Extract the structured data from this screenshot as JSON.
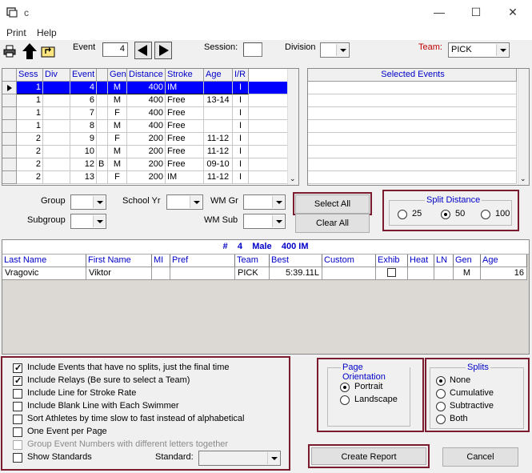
{
  "window": {
    "title": "c",
    "minimize": "—",
    "maximize": "☐",
    "close": "✕"
  },
  "menu": [
    "Print",
    "Help"
  ],
  "toolbar": {
    "event_label": "Event",
    "event_value": "4",
    "session_label": "Session:",
    "session_value": "",
    "division_label": "Division",
    "division_value": "",
    "team_label": "Team:",
    "team_value": "PICK",
    "team_color": "#c00000"
  },
  "events_grid": {
    "headers": [
      "Sess",
      "Div",
      "Event",
      "",
      "Gen",
      "Distance",
      "Stroke",
      "Age",
      "I/R"
    ],
    "rows": [
      [
        "1",
        "",
        "4",
        "",
        "M",
        "400",
        "IM",
        "",
        "I"
      ],
      [
        "1",
        "",
        "6",
        "",
        "M",
        "400",
        "Free",
        "13-14",
        "I"
      ],
      [
        "1",
        "",
        "7",
        "",
        "F",
        "400",
        "Free",
        "",
        "I"
      ],
      [
        "1",
        "",
        "8",
        "",
        "M",
        "400",
        "Free",
        "",
        "I"
      ],
      [
        "2",
        "",
        "9",
        "",
        "F",
        "200",
        "Free",
        "11-12",
        "I"
      ],
      [
        "2",
        "",
        "10",
        "",
        "M",
        "200",
        "Free",
        "11-12",
        "I"
      ],
      [
        "2",
        "",
        "12",
        "B",
        "M",
        "200",
        "Free",
        "09-10",
        "I"
      ],
      [
        "2",
        "",
        "13",
        "",
        "F",
        "200",
        "IM",
        "11-12",
        "I"
      ]
    ],
    "selected_row": 0
  },
  "selected_events": {
    "header": "Selected Events"
  },
  "filters": {
    "group_label": "Group",
    "subgroup_label": "Subgroup",
    "school_yr_label": "School Yr",
    "wm_gr_label": "WM Gr",
    "wm_sub_label": "WM Sub"
  },
  "buttons": {
    "select_all": "Select All",
    "clear_all": "Clear All",
    "create_report": "Create Report",
    "cancel": "Cancel"
  },
  "split_distance": {
    "title": "Split Distance",
    "options": [
      "25",
      "50",
      "100"
    ],
    "selected": 1
  },
  "swimmers": {
    "title_parts": [
      "#",
      "4",
      "Male",
      "400 IM"
    ],
    "headers": [
      "Last Name",
      "First Name",
      "MI",
      "Pref",
      "Team",
      "Best",
      "Custom",
      "Exhib",
      "Heat",
      "LN",
      "Gen",
      "Age"
    ],
    "rows": [
      [
        "Vragovic",
        "Viktor",
        "",
        "",
        "PICK",
        "5:39.11L",
        "",
        "",
        "",
        "",
        "M",
        "16"
      ]
    ]
  },
  "options": [
    {
      "label": "Include Events that have no splits, just the final time",
      "checked": true,
      "enabled": true
    },
    {
      "label": "Include Relays   (Be sure to select a Team)",
      "checked": true,
      "enabled": true
    },
    {
      "label": "Include Line for Stroke Rate",
      "checked": false,
      "enabled": true
    },
    {
      "label": "Include Blank Line with Each Swimmer",
      "checked": false,
      "enabled": true
    },
    {
      "label": "Sort Athletes by time slow to fast instead of alphabetical",
      "checked": false,
      "enabled": true
    },
    {
      "label": "One Event per Page",
      "checked": false,
      "enabled": true
    },
    {
      "label": "Group Event Numbers with different letters together",
      "checked": false,
      "enabled": false
    },
    {
      "label": "Show Standards",
      "checked": false,
      "enabled": true
    }
  ],
  "standard_label": "Standard:",
  "page_orientation": {
    "title": "Page Orientation",
    "options": [
      "Portrait",
      "Landscape"
    ],
    "selected": 0
  },
  "splits": {
    "title": "Splits",
    "options": [
      "None",
      "Cumulative",
      "Subtractive",
      "Both"
    ],
    "selected": 0
  },
  "colors": {
    "header_blue": "#0000c8",
    "selection": "#0000ff",
    "highlight_border": "#7b1c2e"
  }
}
